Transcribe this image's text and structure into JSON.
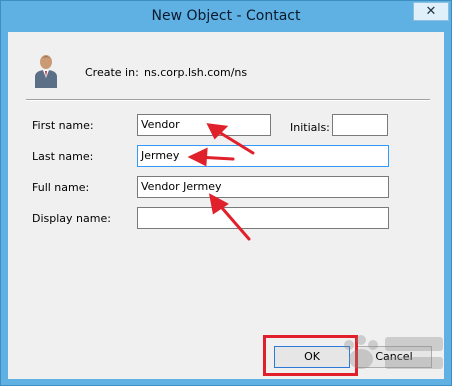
{
  "window": {
    "title": "New Object - Contact",
    "close_glyph": "✕"
  },
  "header": {
    "create_in_label": "Create in:",
    "create_in_path": "ns.corp.lsh.com/ns",
    "icon": "contact-person-icon"
  },
  "form": {
    "first_name_label": "First name:",
    "first_name_value": "Vendor",
    "initials_label": "Initials:",
    "initials_value": "",
    "last_name_label": "Last name:",
    "last_name_value": "Jermey",
    "full_name_label": "Full name:",
    "full_name_value": "Vendor Jermey",
    "display_name_label": "Display name:",
    "display_name_value": ""
  },
  "buttons": {
    "ok_label": "OK",
    "cancel_label": "Cancel"
  },
  "annotation": {
    "color": "#e0202a"
  }
}
